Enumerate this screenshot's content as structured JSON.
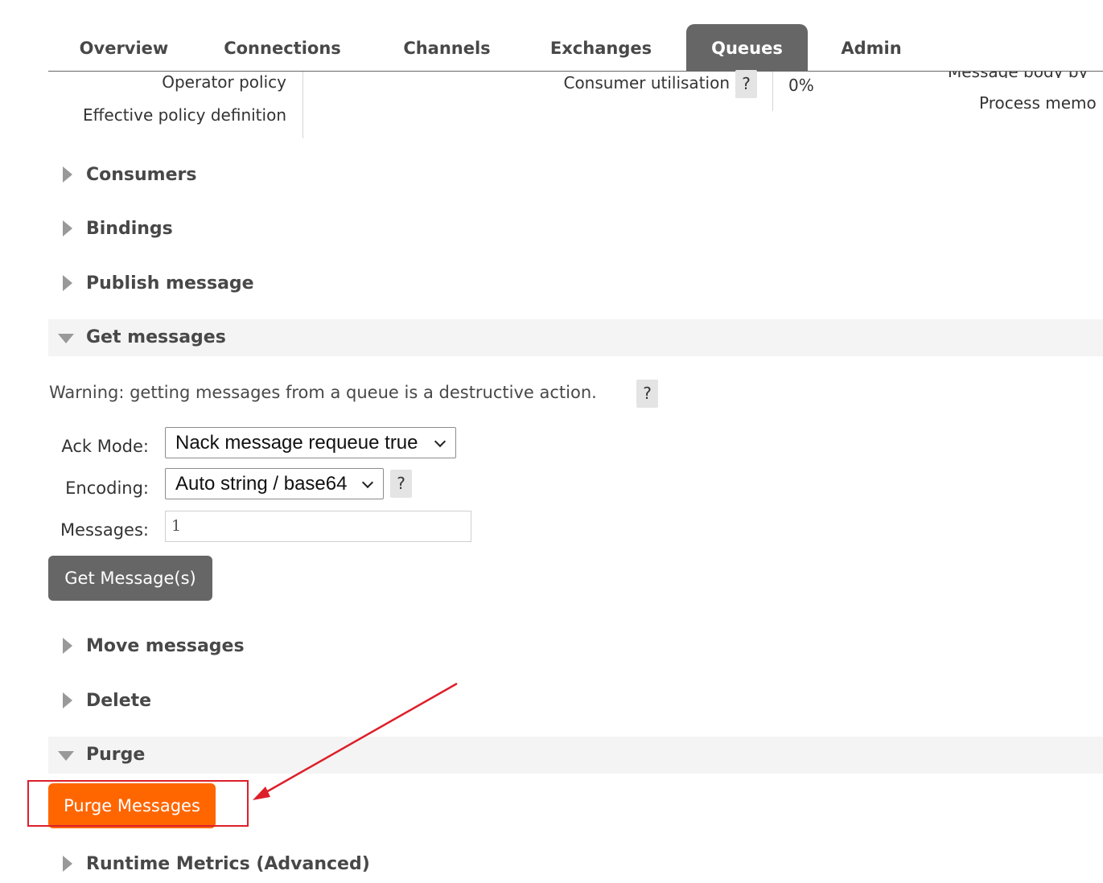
{
  "nav": {
    "tabs": [
      {
        "label": "Overview",
        "active": false
      },
      {
        "label": "Connections",
        "active": false
      },
      {
        "label": "Channels",
        "active": false
      },
      {
        "label": "Exchanges",
        "active": false
      },
      {
        "label": "Queues",
        "active": true
      },
      {
        "label": "Admin",
        "active": false
      }
    ]
  },
  "details": {
    "operator_policy_label": "Operator policy",
    "effective_policy_label": "Effective policy definition",
    "consumer_utilisation_label": "Consumer utilisation",
    "consumer_utilisation_help": "?",
    "consumer_utilisation_value": "0%",
    "message_body_label": "Message body by",
    "process_memory_label": "Process memo"
  },
  "sections": {
    "consumers": "Consumers",
    "bindings": "Bindings",
    "publish_message": "Publish message",
    "get_messages": "Get messages",
    "move_messages": "Move messages",
    "delete": "Delete",
    "purge": "Purge",
    "runtime_metrics": "Runtime Metrics (Advanced)"
  },
  "get_messages": {
    "warning": "Warning: getting messages from a queue is a destructive action.",
    "warning_help": "?",
    "ack_mode_label": "Ack Mode:",
    "ack_mode_value": "Nack message requeue true",
    "encoding_label": "Encoding:",
    "encoding_value": "Auto string / base64",
    "encoding_help": "?",
    "messages_label": "Messages:",
    "messages_value": "1",
    "get_button": "Get Message(s)"
  },
  "purge": {
    "button": "Purge Messages"
  },
  "colors": {
    "nav_active_bg": "#666666",
    "purge_button": "#ff6600",
    "annotation": "#dd1f2a"
  }
}
